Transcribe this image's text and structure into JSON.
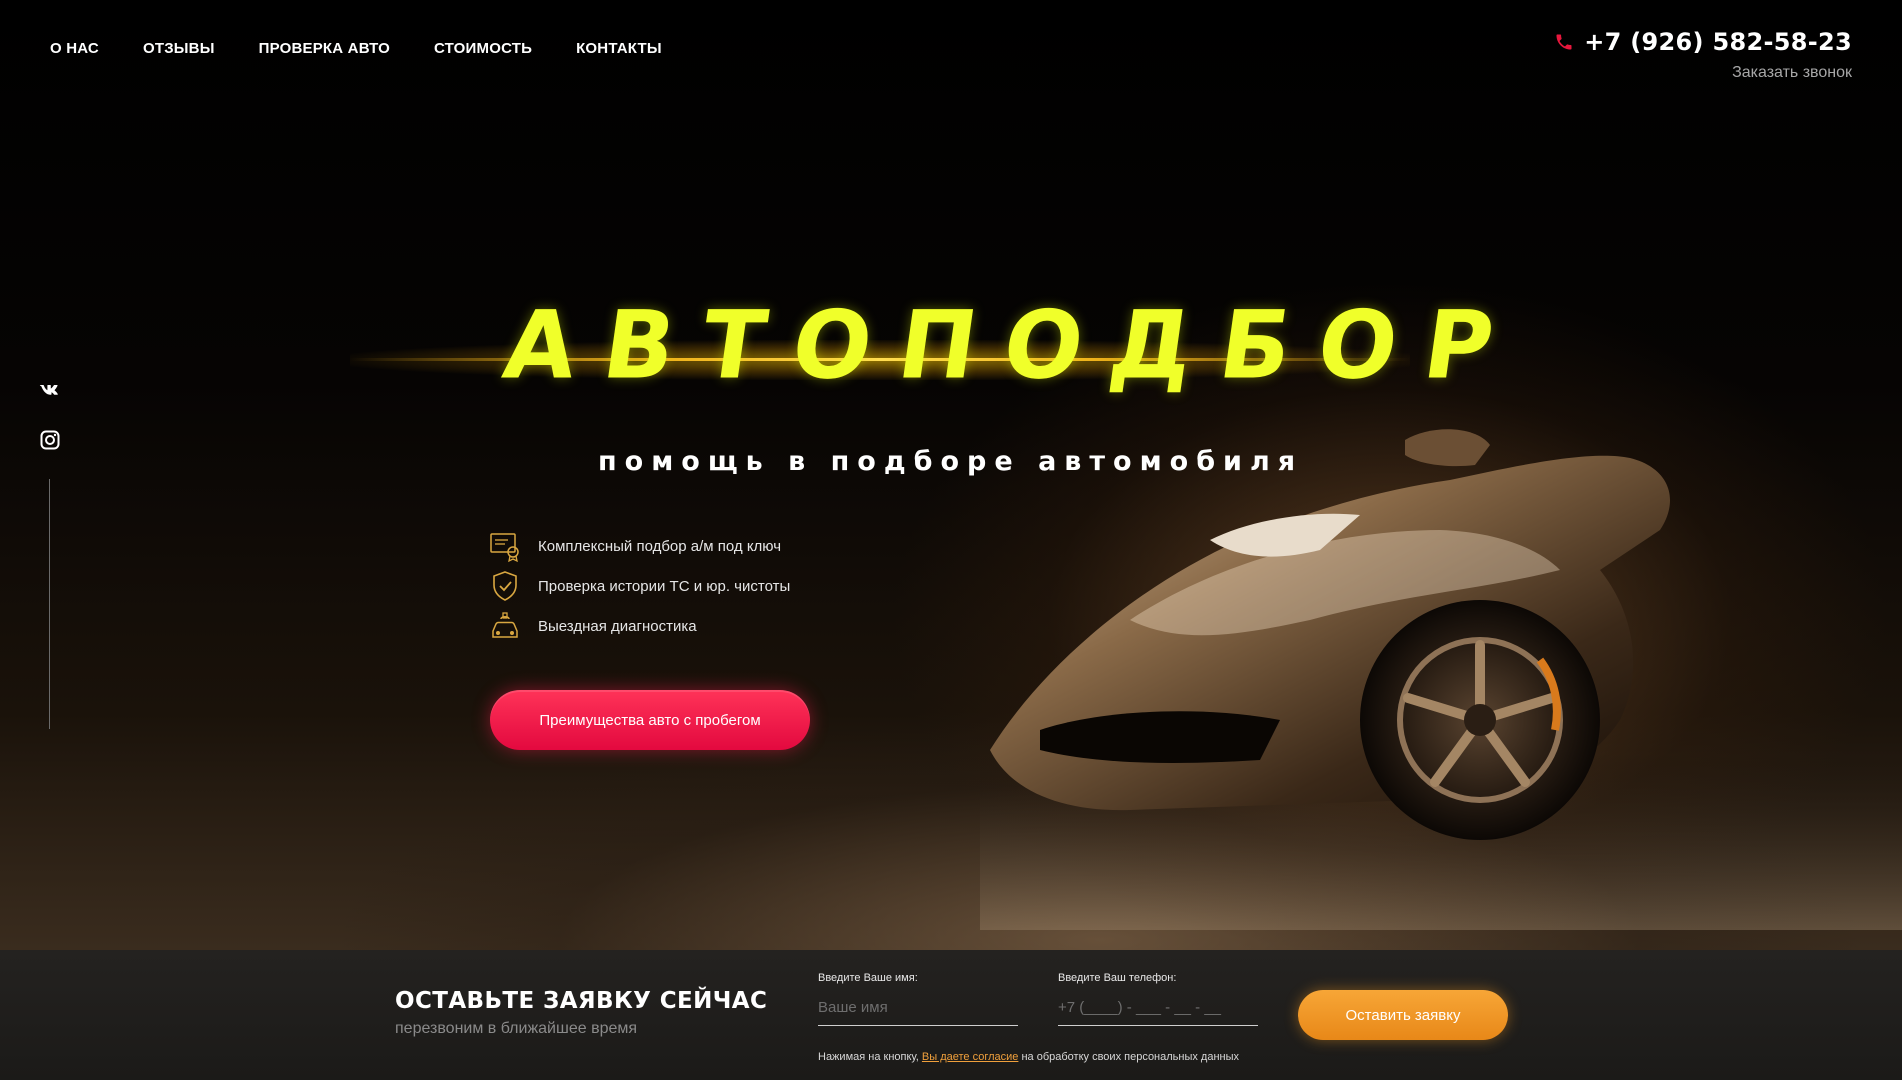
{
  "nav": {
    "items": [
      {
        "label": "О НАС"
      },
      {
        "label": "ОТЗЫВЫ"
      },
      {
        "label": "ПРОВЕРКА АВТО"
      },
      {
        "label": "СТОИМОСТЬ"
      },
      {
        "label": "КОНТАКТЫ"
      }
    ]
  },
  "contact": {
    "phone": "+7 (926) 582-58-23",
    "callback": "Заказать звонок"
  },
  "social": {
    "items": [
      {
        "icon": "vk-icon"
      },
      {
        "icon": "instagram-icon"
      }
    ]
  },
  "hero": {
    "title": "АВТОПОДБОР",
    "subtitle": "помощь в подборе автомобиля",
    "features": [
      {
        "icon": "certificate-icon",
        "label": "Комплексный подбор а/м под ключ"
      },
      {
        "icon": "shield-check-icon",
        "label": "Проверка истории ТС и юр. чистоты"
      },
      {
        "icon": "car-diagnostics-icon",
        "label": "Выездная диагностика"
      }
    ],
    "cta_label": "Преимущества авто с пробегом"
  },
  "form": {
    "title": "ОСТАВЬТЕ ЗАЯВКУ СЕЙЧАС",
    "subtitle": "перезвоним в ближайшее время",
    "name_label": "Введите Ваше имя:",
    "name_placeholder": "Ваше имя",
    "phone_label": "Введите Ваш телефон:",
    "phone_placeholder": "+7 (____) - ___ - __ - __",
    "submit_label": "Оставить заявку",
    "consent_prefix": "Нажимая на кнопку, ",
    "consent_link": "Вы даете согласие",
    "consent_suffix": " на обработку своих персональных данных"
  },
  "colors": {
    "title_yellow": "#f0ff2a",
    "cta_red": "#e3093f",
    "submit_orange": "#f39a2a",
    "phone_icon_red": "#e8173d",
    "feature_icon_gold": "#d9a741"
  }
}
